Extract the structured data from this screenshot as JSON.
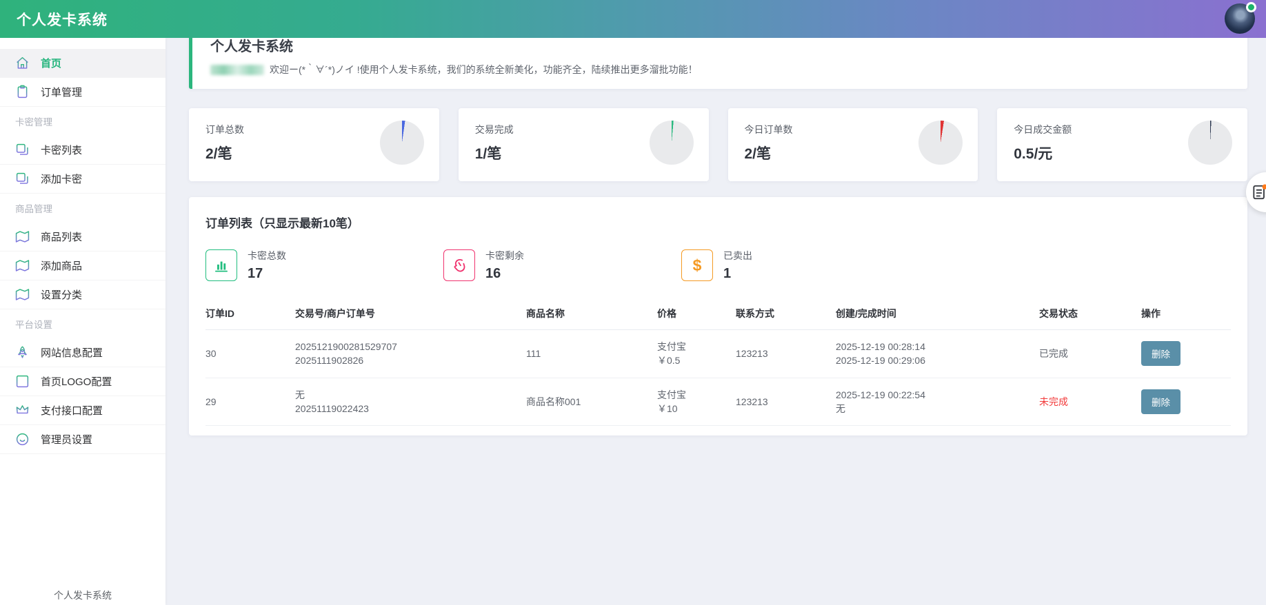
{
  "header": {
    "title": "个人发卡系统",
    "avatar_status": "online"
  },
  "sidebar": {
    "items": [
      {
        "type": "link",
        "label": "首页",
        "icon": "home-icon",
        "active": true
      },
      {
        "type": "link",
        "label": "订单管理",
        "icon": "clipboard-icon"
      },
      {
        "type": "section",
        "label": "卡密管理"
      },
      {
        "type": "link",
        "label": "卡密列表",
        "icon": "copy-icon"
      },
      {
        "type": "link",
        "label": "添加卡密",
        "icon": "copy-icon"
      },
      {
        "type": "section",
        "label": "商品管理"
      },
      {
        "type": "link",
        "label": "商品列表",
        "icon": "map-icon"
      },
      {
        "type": "link",
        "label": "添加商品",
        "icon": "map-icon"
      },
      {
        "type": "link",
        "label": "设置分类",
        "icon": "map-icon"
      },
      {
        "type": "section",
        "label": "平台设置"
      },
      {
        "type": "link",
        "label": "网站信息配置",
        "icon": "rocket-icon"
      },
      {
        "type": "link",
        "label": "首页LOGO配置",
        "icon": "layout-icon"
      },
      {
        "type": "link",
        "label": "支付接口配置",
        "icon": "crown-icon"
      },
      {
        "type": "link",
        "label": "管理员设置",
        "icon": "smile-icon"
      }
    ],
    "footer": "个人发卡系统"
  },
  "welcome": {
    "title": "个人发卡系统",
    "message": "欢迎ー(*｀∀´*)ノイ !使用个人发卡系统，我们的系统全新美化，功能齐全，陆续推出更多溜批功能！"
  },
  "stat_cards": [
    {
      "label": "订单总数",
      "value": "2/笔",
      "accent": "#4a68e0",
      "slice_deg": 8
    },
    {
      "label": "交易完成",
      "value": "1/笔",
      "accent": "#2bb980",
      "slice_deg": 5
    },
    {
      "label": "今日订单数",
      "value": "2/笔",
      "accent": "#e03434",
      "slice_deg": 9
    },
    {
      "label": "今日成交金额",
      "value": "0.5/元",
      "accent": "#2e3a52",
      "slice_deg": 3
    }
  ],
  "orders": {
    "title": "订单列表（只显示最新10笔）",
    "stats": [
      {
        "label": "卡密总数",
        "value": "17",
        "color": "#20bd7e",
        "icon": "bar-chart-icon"
      },
      {
        "label": "卡密剩余",
        "value": "16",
        "color": "#f0326e",
        "icon": "swipe-hand-icon"
      },
      {
        "label": "已卖出",
        "value": "1",
        "color": "#f59a23",
        "icon": "dollar-icon"
      }
    ],
    "columns": [
      "订单ID",
      "交易号/商户订单号",
      "商品名称",
      "价格",
      "联系方式",
      "创建/完成时间",
      "交易状态",
      "操作"
    ],
    "rows": [
      {
        "id": "30",
        "trade_no": "2025121900281529707",
        "merchant_no": "2025111902826",
        "product": "111",
        "pay_method": "支付宝",
        "price": "￥0.5",
        "contact": "123213",
        "created": "2025-12-19 00:28:14",
        "completed": "2025-12-19 00:29:06",
        "status": "已完成",
        "status_color": "#5f646d",
        "action": "删除"
      },
      {
        "id": "29",
        "trade_no": "无",
        "merchant_no": "20251119022423",
        "product": "商品名称001",
        "pay_method": "支付宝",
        "price": "￥10",
        "contact": "123213",
        "created": "2025-12-19 00:22:54",
        "completed": "无",
        "status": "未完成",
        "status_color": "#f23a3a",
        "action": "删除"
      }
    ]
  },
  "colors": {
    "brand_green": "#2bb67d",
    "header_gradient_start": "#2fb27c",
    "header_gradient_end": "#8a70d0",
    "delete_button": "#5a8fa8",
    "status_incomplete": "#f23a3a",
    "pie_base": "#e9eaec"
  }
}
